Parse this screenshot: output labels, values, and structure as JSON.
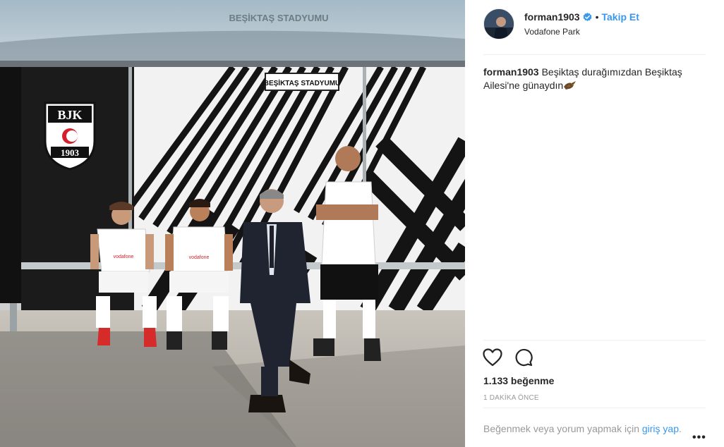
{
  "post": {
    "photo_alt": "Beşiktaş bus stop with player cutouts",
    "stop_sign": "BEŞİKTAŞ STADYUMU",
    "roof_text": "BEŞİKTAŞ STADYUMU",
    "crest_letters": "BJK",
    "crest_year": "1903",
    "jersey_sponsor": "vodafone"
  },
  "header": {
    "username": "forman1903",
    "separator": "•",
    "follow_label": "Takip Et",
    "location": "Vodafone Park"
  },
  "caption": {
    "username": "forman1903",
    "text": "Beşiktaş durağımızdan Beşiktaş Ailesi'ne günaydın"
  },
  "stats": {
    "likes": "1.133 beğenme",
    "time": "1 DAKİKA ÖNCE"
  },
  "footer": {
    "prompt": "Beğenmek veya yorum yapmak için ",
    "login_link": "giriş yap",
    "prompt_end": ".",
    "more": "•••"
  },
  "icons": {
    "verified": "verified-badge-icon",
    "like": "heart-icon",
    "comment": "comment-icon",
    "more": "more-options-icon"
  },
  "colors": {
    "link": "#3897f0",
    "text": "#262626",
    "muted": "#999999",
    "border": "#efefef"
  }
}
